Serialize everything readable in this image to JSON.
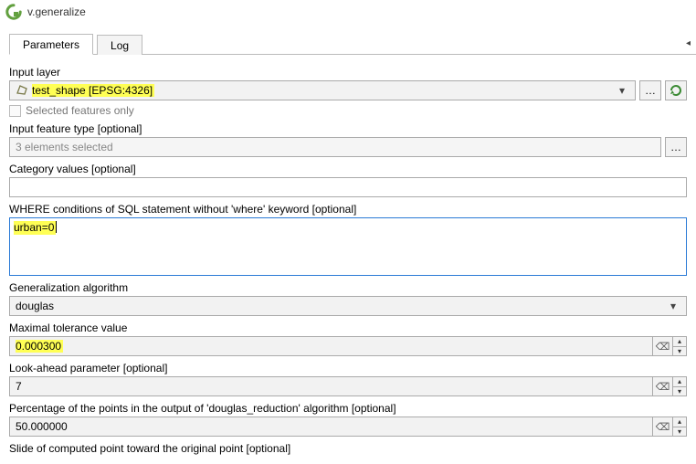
{
  "window": {
    "title": "v.generalize"
  },
  "tabs": {
    "parameters": "Parameters",
    "log": "Log"
  },
  "labels": {
    "input_layer": "Input layer",
    "selected_only": "Selected features only",
    "feature_type": "Input feature type [optional]",
    "category_values": "Category values [optional]",
    "where": "WHERE conditions of SQL statement without 'where' keyword [optional]",
    "algorithm": "Generalization algorithm",
    "tolerance": "Maximal tolerance value",
    "lookahead": "Look-ahead parameter [optional]",
    "percentage": "Percentage of the points in the output of 'douglas_reduction' algorithm [optional]",
    "cutoff": "Slide of computed point toward the original point [optional]"
  },
  "values": {
    "input_layer": "test_shape [EPSG:4326]",
    "feature_type": "3 elements selected",
    "category_values": "",
    "where": "urban=0",
    "algorithm": "douglas",
    "tolerance": "0.000300",
    "lookahead": "7",
    "percentage": "50.000000"
  },
  "icons": {
    "browse": "…",
    "caret": "▾",
    "clear": "⌫",
    "up": "▴",
    "down": "▾",
    "panel_chevron": "◂"
  }
}
